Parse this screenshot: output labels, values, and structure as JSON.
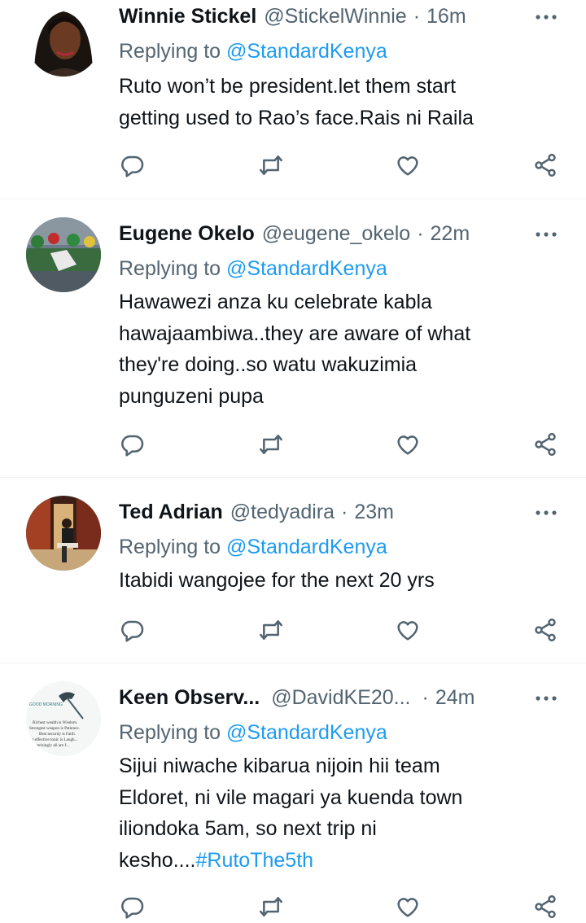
{
  "reply_prefix": "Replying to",
  "tweets": [
    {
      "name": "Winnie Stickel",
      "handle": "@StickelWinnie",
      "separator": "·",
      "time": "16m",
      "replying_to": "@StandardKenya",
      "lines": [
        "Ruto won’t be president.let them start",
        "getting used to Rao’s face.Rais ni Raila"
      ],
      "hashtag": ""
    },
    {
      "name": "Eugene Okelo",
      "handle": "@eugene_okelo",
      "separator": "·",
      "time": "22m",
      "replying_to": "@StandardKenya",
      "lines": [
        "Hawawezi anza ku celebrate kabla",
        "hawajaambiwa..they are aware of what",
        "they're doing..so watu wakuzimia",
        "punguzeni pupa"
      ],
      "hashtag": ""
    },
    {
      "name": "Ted Adrian",
      "handle": "@tedyadira",
      "separator": "·",
      "time": "23m",
      "replying_to": "@StandardKenya",
      "lines": [
        "Itabidi wangojee for the next 20 yrs"
      ],
      "hashtag": ""
    },
    {
      "name": "Keen Observ...",
      "handle": "@DavidKE20...",
      "separator": "·",
      "time": "24m",
      "replying_to": "@StandardKenya",
      "lines": [
        "Sijui niwache kibarua nijoin hii team",
        "Eldoret, ni vile magari ya kuenda town",
        "iliondoka 5am, so next trip ni",
        "kesho...."
      ],
      "hashtag": "#RutoThe5th"
    }
  ],
  "avatar_texts": {
    "keen": [
      "GOOD MORNING",
      "Richest wealth is Wisdom.",
      "Strongest weapon is Patience.",
      "Best security is Faith.",
      "...t effective tonic is Laugh...",
      "...rprisingly all are f..."
    ]
  },
  "icons": {
    "more": "more-horizontal-icon",
    "reply": "reply-icon",
    "retweet": "retweet-icon",
    "like": "like-icon",
    "share": "share-icon"
  },
  "colors": {
    "link_blue": "#1d9bf0",
    "secondary_text": "#536471",
    "primary_text": "#0f1419",
    "divider": "#eff3f4"
  }
}
